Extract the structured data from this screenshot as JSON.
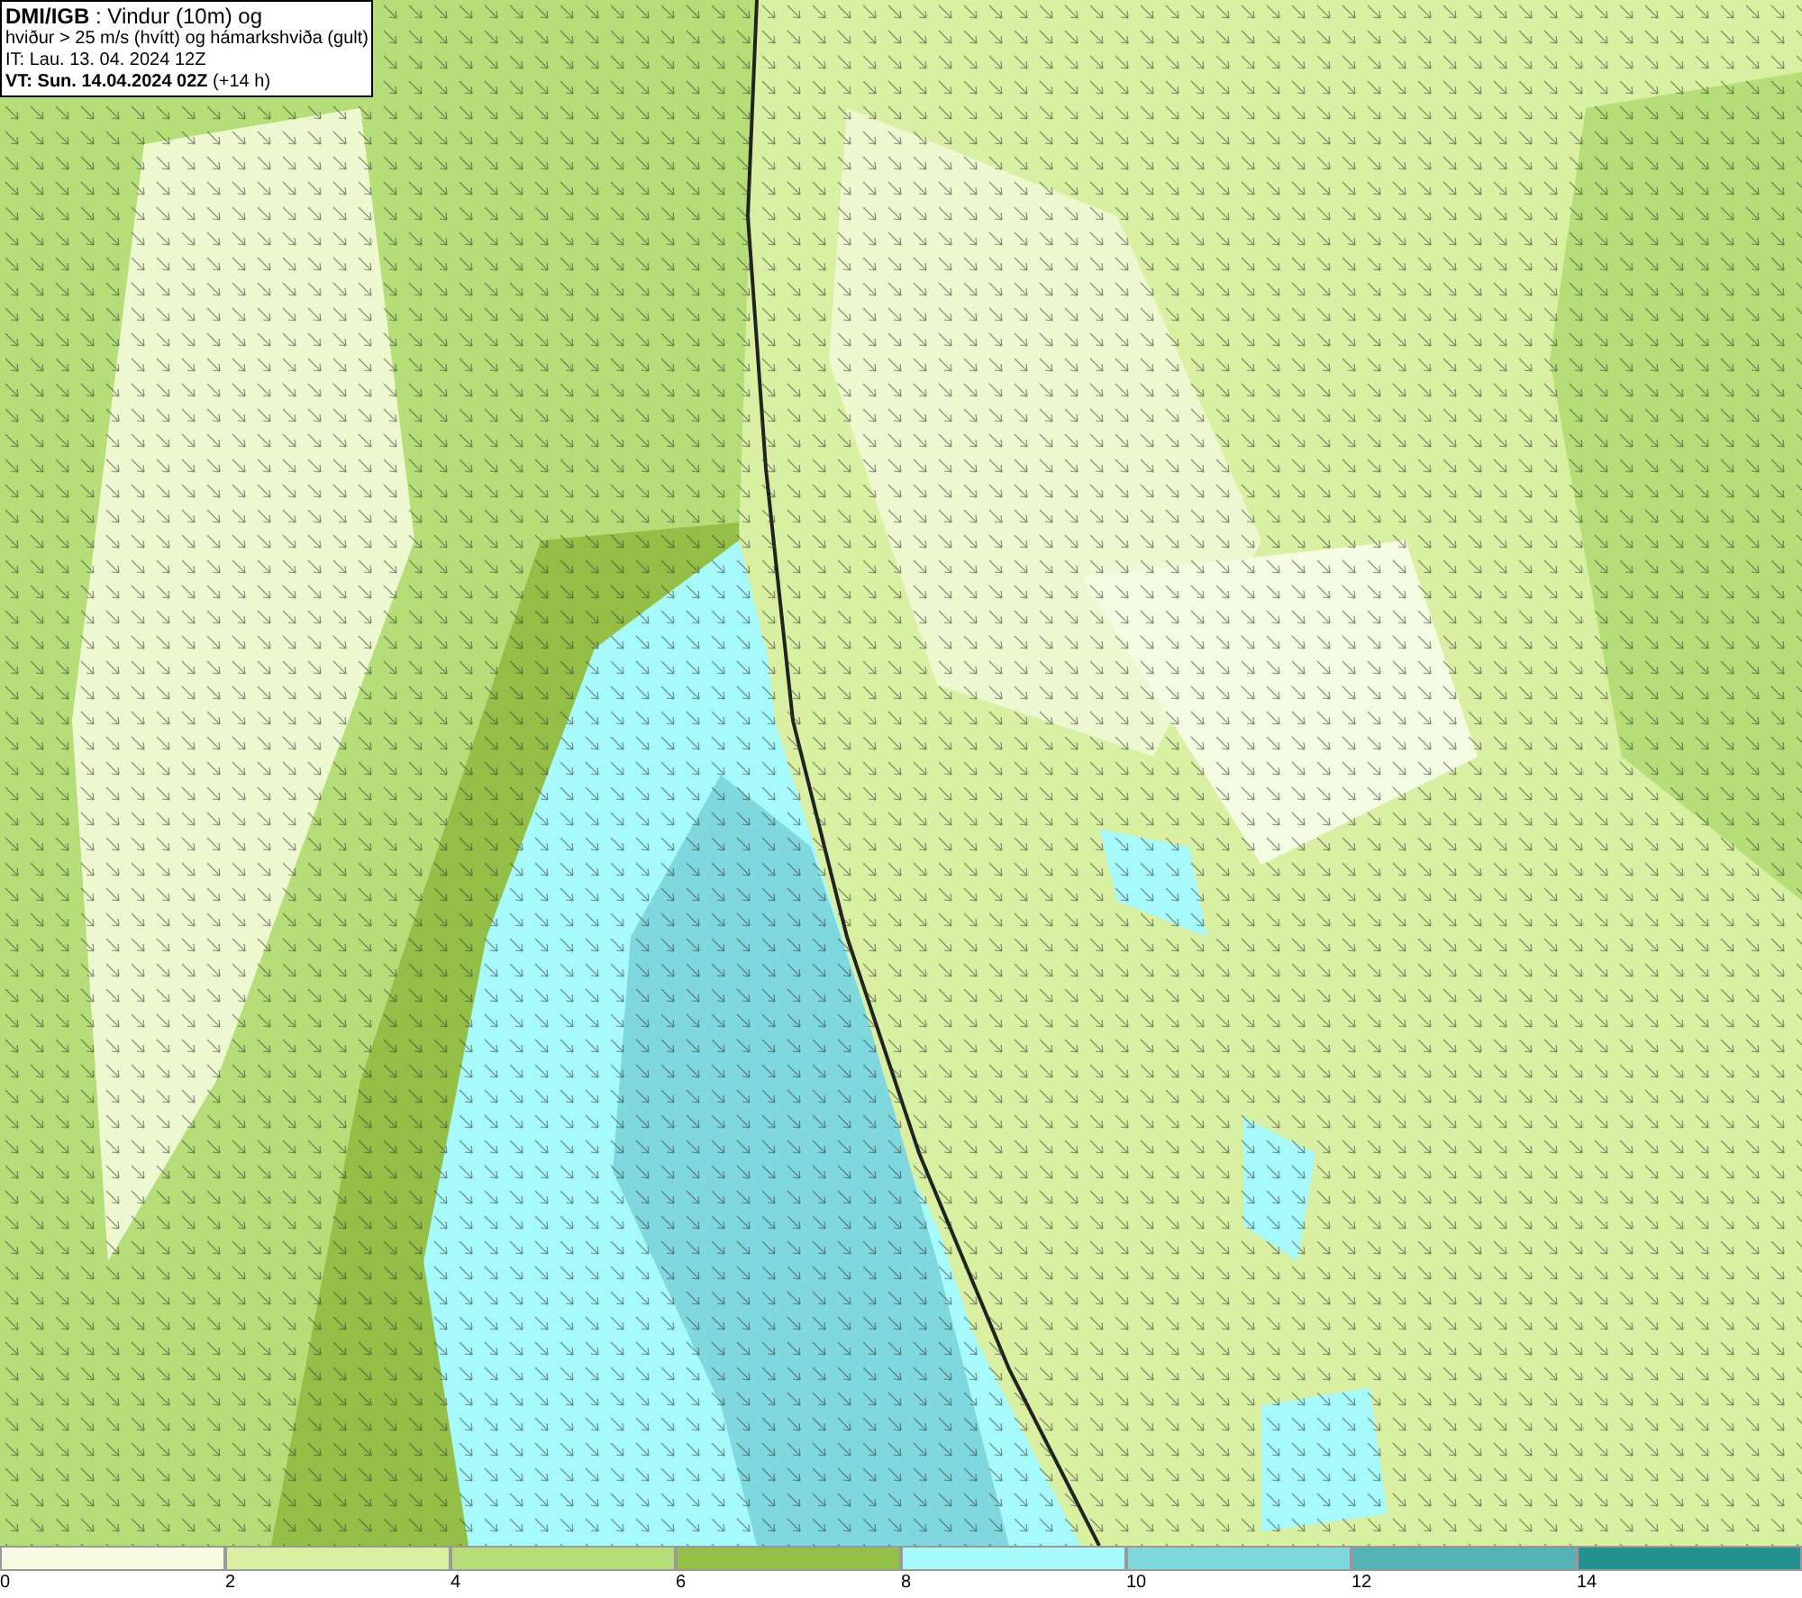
{
  "header": {
    "lines": [
      "**DMI/IGB** : Vindur (10m) og",
      "hviður > 25 m/s (hvítt) og hámarkshviða (gult)",
      "IT: Lau. 13. 04. 2024 12Z",
      "**VT: Sun. 14.04.2024 02Z** (+14 h)"
    ]
  },
  "legend": {
    "bins": [
      {
        "color": "#f4fbe0"
      },
      {
        "color": "#d9f0a3"
      },
      {
        "color": "#b5dd78"
      },
      {
        "color": "#93bf46"
      },
      {
        "color": "#a6fafc"
      },
      {
        "color": "#7fd8dd"
      },
      {
        "color": "#52b2b5"
      },
      {
        "color": "#23918f"
      }
    ],
    "ticks": [
      "0",
      "2",
      "4",
      "6",
      "8",
      "10",
      "12",
      "14"
    ]
  }
}
